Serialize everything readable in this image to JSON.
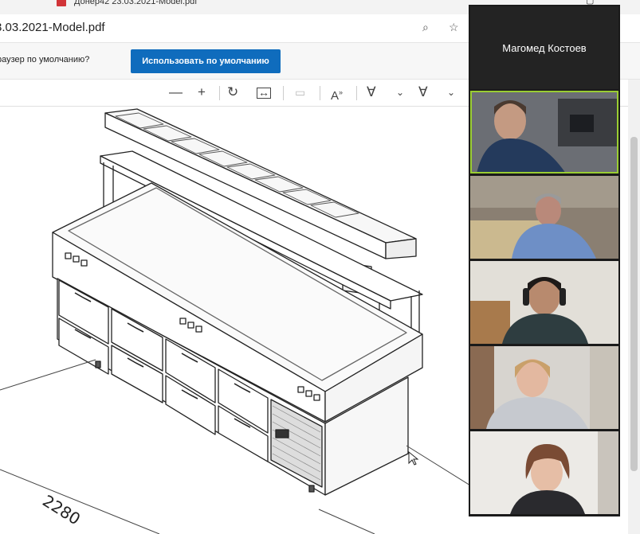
{
  "window": {
    "title": "Донер42 23.03.2021-Model.pdf"
  },
  "address": {
    "url": "3.03.2021-Model.pdf"
  },
  "infobar": {
    "message": "раузер по умолчанию?",
    "button_label": "Использовать по умолчанию"
  },
  "drawing": {
    "dimension_label": "2280"
  },
  "video_panel": {
    "speaker_name": "Магомед Костоев",
    "participant_count": 5
  }
}
